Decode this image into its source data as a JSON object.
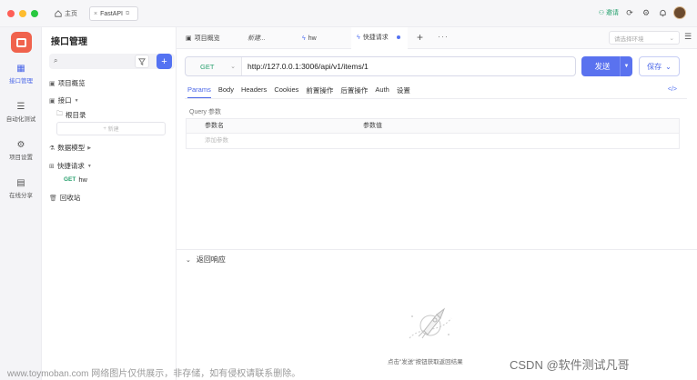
{
  "titlebar": {
    "home_label": "主页",
    "project_tab": "FastAPI",
    "invite_label": "邀请",
    "colors": {
      "close": "#fe5f57",
      "minimize": "#febc2e",
      "maximize": "#28c840"
    }
  },
  "rail": {
    "items": [
      {
        "label": "接口管理",
        "icon": "api-icon",
        "active": true
      },
      {
        "label": "自动化测试",
        "icon": "test-icon",
        "active": false
      },
      {
        "label": "项目设置",
        "icon": "settings-icon",
        "active": false
      },
      {
        "label": "在线分享",
        "icon": "share-icon",
        "active": false
      }
    ]
  },
  "sidebar": {
    "title": "接口管理",
    "new_label": "新建",
    "items": {
      "overview": "项目概览",
      "interfaces": "接口",
      "root": "根目录",
      "data_model": "数据模型",
      "quick_request": "快捷请求",
      "request_method": "GET",
      "request_name": "hw",
      "trash": "回收站"
    }
  },
  "tabs": {
    "overview": "项目概览",
    "new": "新建...",
    "hw": "hw",
    "quick": "快捷请求",
    "env_placeholder": "请选择环境"
  },
  "request": {
    "method": "GET",
    "url": "http://127.0.0.1:3006/api/v1/items/1",
    "send_label": "发送",
    "save_label": "保存",
    "tabs": [
      "Params",
      "Body",
      "Headers",
      "Cookies",
      "前置操作",
      "后置操作",
      "Auth",
      "设置"
    ],
    "active_tab": "Params"
  },
  "params": {
    "section_label": "Query 参数",
    "col_name": "参数名",
    "col_value": "参数值",
    "add_placeholder": "添加参数"
  },
  "response": {
    "title": "返回响应",
    "empty_hint": "点击\"发送\"按钮获取返回结果"
  },
  "watermark": {
    "left": "www.toymoban.com 网络图片仅供展示，非存储，如有侵权请联系删除。",
    "right": "CSDN @软件测试凡哥"
  },
  "accent": "#5472f2"
}
